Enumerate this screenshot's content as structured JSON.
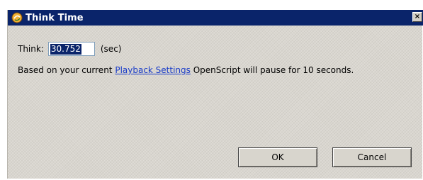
{
  "dialog": {
    "title": "Think Time",
    "close_symbol": "×",
    "title_icon": "openscript-app-icon"
  },
  "think": {
    "label": "Think:",
    "value": "30.752",
    "unit": "(sec)"
  },
  "info": {
    "prefix": "Based on your current ",
    "link": "Playback Settings",
    "suffix": " OpenScript will pause for 10 seconds."
  },
  "buttons": {
    "ok": "OK",
    "cancel": "Cancel"
  },
  "colors": {
    "titlebar": "#0a246a",
    "link": "#1a3cc8",
    "selection": "#0a246a"
  }
}
